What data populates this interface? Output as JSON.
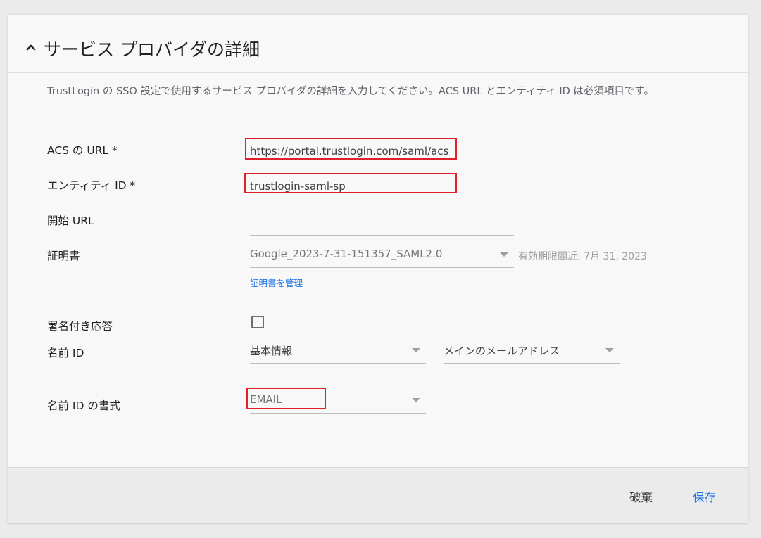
{
  "header": {
    "title": "サービス プロバイダの詳細",
    "collapse_icon": "chevron-up-icon"
  },
  "description": "TrustLogin の SSO 設定で使用するサービス プロバイダの詳細を入力してください。ACS URL とエンティティ ID は必須項目です。",
  "form": {
    "acs_url": {
      "label": "ACS の URL *",
      "value": "https://portal.trustlogin.com/saml/acs"
    },
    "entity_id": {
      "label": "エンティティ ID *",
      "value": "trustlogin-saml-sp"
    },
    "start_url": {
      "label": "開始 URL",
      "value": ""
    },
    "certificate": {
      "label": "証明書",
      "value": "Google_2023-7-31-151357_SAML2.0",
      "expiry": "有効期限間近: 7月 31, 2023",
      "manage_link": "証明書を管理"
    },
    "signed_response": {
      "label": "署名付き応答",
      "checked": false
    },
    "name_id": {
      "label": "名前 ID",
      "category": "基本情報",
      "attribute": "メインのメールアドレス"
    },
    "name_id_format": {
      "label": "名前 ID の書式",
      "value": "EMAIL"
    }
  },
  "footer": {
    "discard_label": "破棄",
    "save_label": "保存"
  },
  "colors": {
    "accent": "#1a73e8",
    "highlight": "#e0202b"
  }
}
